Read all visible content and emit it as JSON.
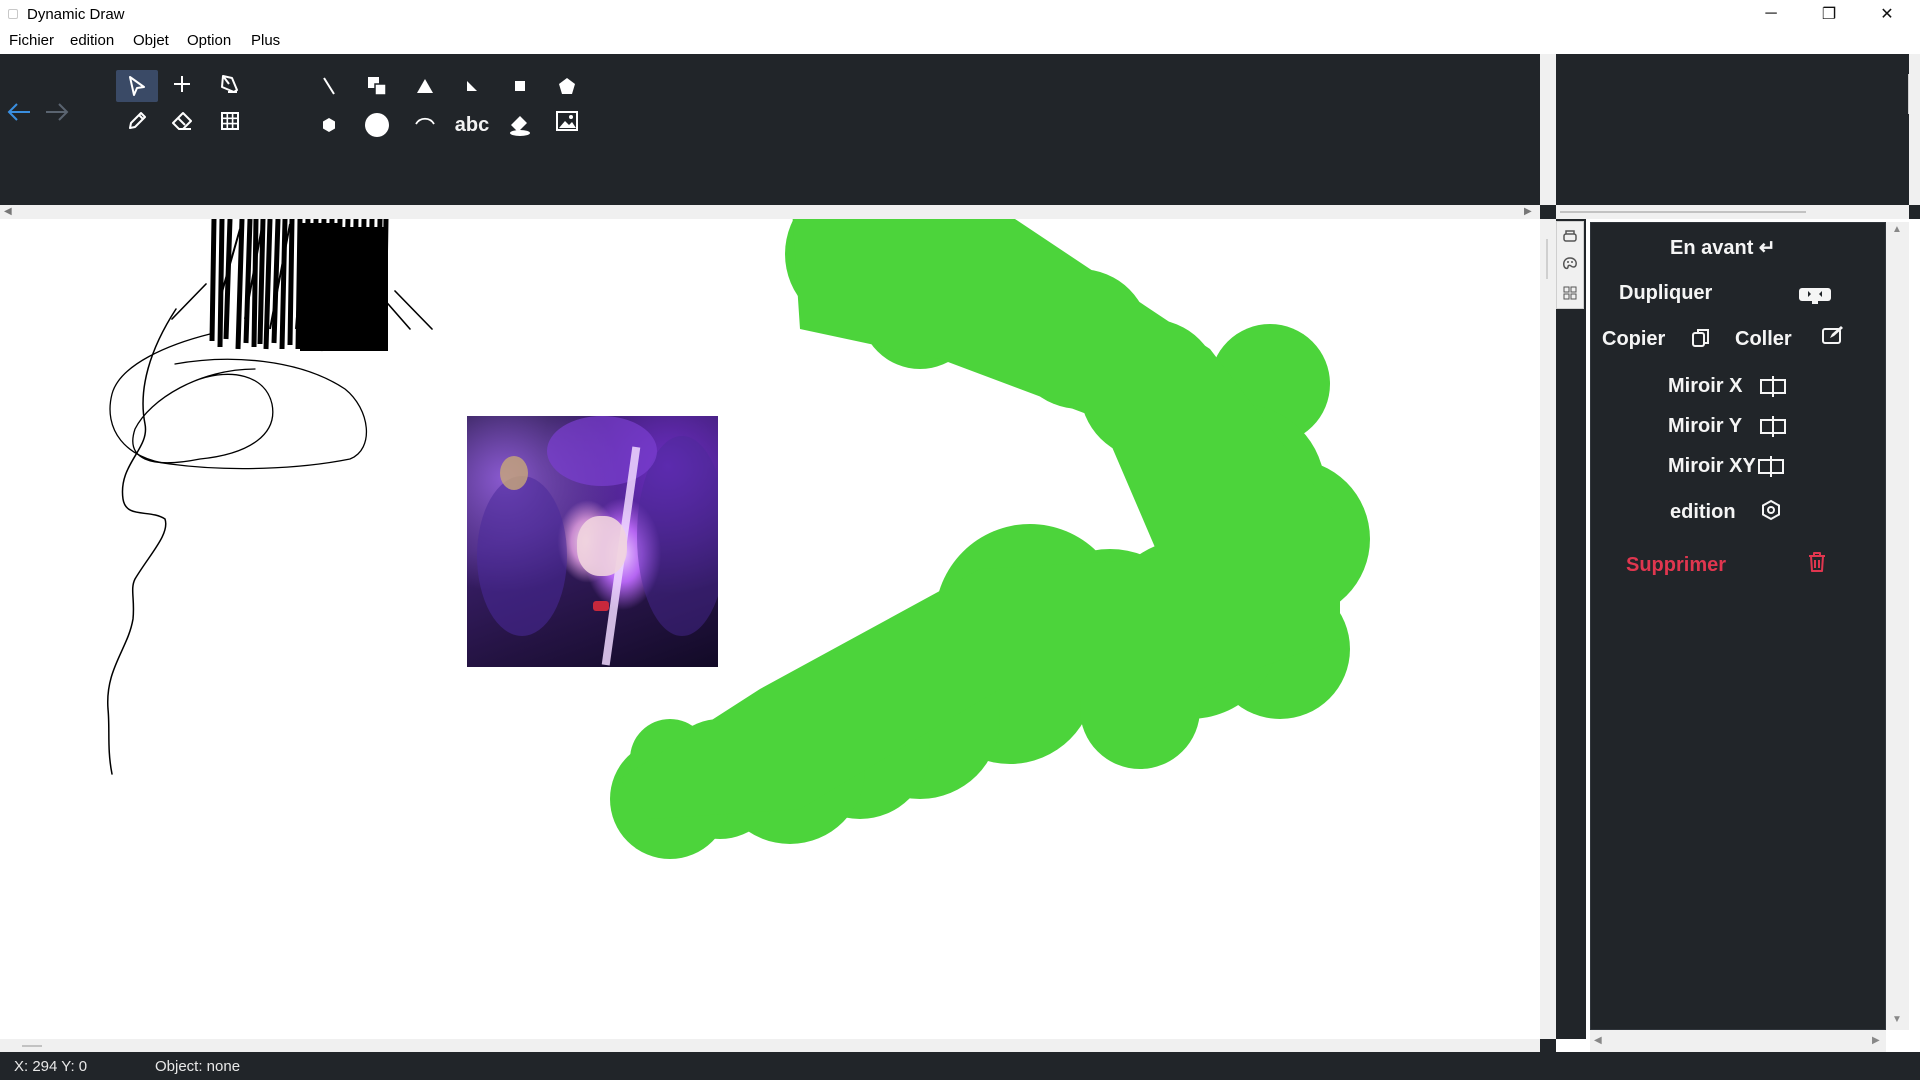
{
  "window": {
    "title": "Dynamic Draw",
    "controls": {
      "minimize": "─",
      "maximize": "❐",
      "close": "✕"
    }
  },
  "menu": [
    "Fichier",
    "edition",
    "Objet",
    "Option",
    "Plus"
  ],
  "toolbar": {
    "undo_icon": "arrow-left-icon",
    "redo_icon": "arrow-right-icon",
    "tools": [
      {
        "id": "select",
        "icon": "cursor-icon",
        "active": true
      },
      {
        "id": "add-point",
        "icon": "plus-icon"
      },
      {
        "id": "node-edit",
        "icon": "pen-nib-icon"
      },
      {
        "id": "pencil",
        "icon": "pencil-icon"
      },
      {
        "id": "eraser",
        "icon": "eraser-icon"
      },
      {
        "id": "grid",
        "icon": "grid-icon"
      }
    ],
    "shapes_text_label": "abc"
  },
  "properties": {
    "bring_forward": "En avant ↵",
    "duplicate": "Dupliquer",
    "copy": "Copier",
    "paste": "Coller",
    "mirror_x": "Miroir X",
    "mirror_y": "Miroir Y",
    "mirror_xy": "Miroir XY",
    "edit": "edition",
    "delete": "Supprimer"
  },
  "status": {
    "coords": "X: 294  Y: 0",
    "object": "Object: none"
  },
  "colors": {
    "dark": "#212529",
    "brush_green": "#4cd43b",
    "delete_red": "#e0364f",
    "accent_blue": "#3a8fe0"
  }
}
